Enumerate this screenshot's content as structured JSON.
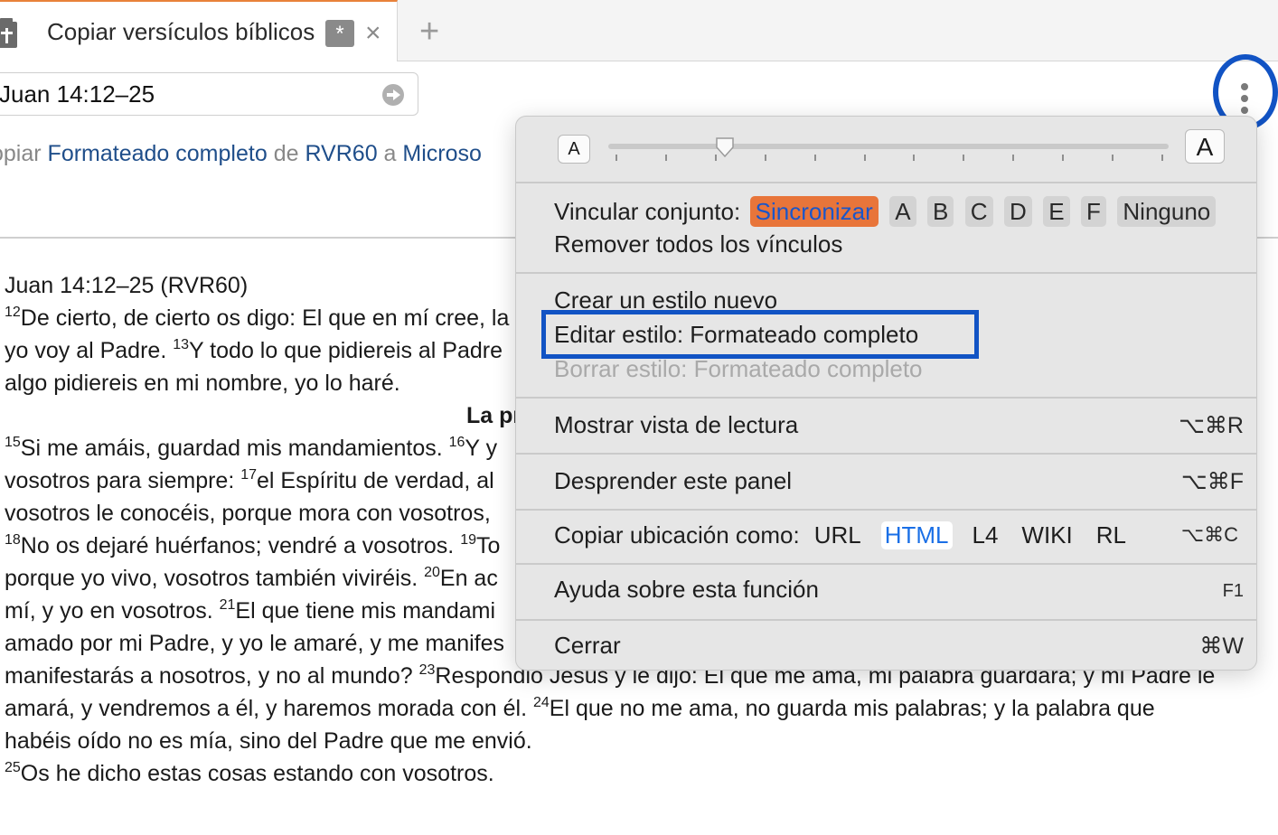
{
  "tab": {
    "title": "Copiar versículos bíblicos",
    "badge": "*",
    "close": "×",
    "add": "+"
  },
  "reference": {
    "value": "Juan 14:12–25"
  },
  "copy_line": {
    "prefix": "opiar",
    "style": "Formateado completo",
    "from_word": "de",
    "version": "RVR60",
    "to_word": "a",
    "target": "Microso"
  },
  "passage": {
    "lines": [
      {
        "segments": [
          {
            "t": "Juan 14:12–25 (RVR60)"
          }
        ]
      },
      {
        "segments": [
          {
            "sup": "12"
          },
          {
            "t": "De cierto, de cierto os digo: El que en mí cree, la"
          }
        ]
      },
      {
        "segments": [
          {
            "t": "yo voy al Padre. "
          },
          {
            "sup": "13"
          },
          {
            "t": "Y todo lo que pidiereis al Padre"
          }
        ]
      },
      {
        "segments": [
          {
            "t": "algo pidiereis en mi nombre, yo lo haré."
          }
        ]
      },
      {
        "heading": "La pr"
      },
      {
        "segments": [
          {
            "sup": "15"
          },
          {
            "t": "Si me amáis, guardad mis mandamientos. "
          },
          {
            "sup": "16"
          },
          {
            "t": "Y y"
          }
        ]
      },
      {
        "segments": [
          {
            "t": "vosotros para siempre: "
          },
          {
            "sup": "17"
          },
          {
            "t": "el Espíritu de verdad, al"
          }
        ]
      },
      {
        "segments": [
          {
            "t": "vosotros le conocéis, porque mora con vosotros,"
          }
        ]
      },
      {
        "segments": [
          {
            "sup": "18"
          },
          {
            "t": "No os dejaré huérfanos; vendré a vosotros. "
          },
          {
            "sup": "19"
          },
          {
            "t": "To"
          }
        ]
      },
      {
        "segments": [
          {
            "t": "porque yo vivo, vosotros también viviréis. "
          },
          {
            "sup": "20"
          },
          {
            "t": "En ac"
          }
        ]
      },
      {
        "segments": [
          {
            "t": "mí, y yo en vosotros. "
          },
          {
            "sup": "21"
          },
          {
            "t": "El que tiene mis mandami"
          }
        ]
      },
      {
        "segments": [
          {
            "t": "amado por mi Padre, y yo le amaré, y me manifes"
          }
        ]
      },
      {
        "segments": [
          {
            "t": "manifestarás a nosotros, y no al mundo? "
          },
          {
            "sup": "23"
          },
          {
            "t": "Respondió Jesús y le dijo: El que me ama, mi palabra guardará; y mi Padre le"
          }
        ]
      },
      {
        "segments": [
          {
            "t": "amará, y vendremos a él, y haremos morada con él. "
          },
          {
            "sup": "24"
          },
          {
            "t": "El que no me ama, no guarda mis palabras; y la palabra que"
          }
        ]
      },
      {
        "segments": [
          {
            "t": "habéis oído no es mía, sino del Padre que me envió."
          }
        ]
      },
      {
        "segments": [
          {
            "sup": "25"
          },
          {
            "t": "Os he dicho estas cosas estando con vosotros."
          }
        ]
      }
    ]
  },
  "menu": {
    "font_small": "A",
    "font_large": "A",
    "font_size_level": 0.2,
    "link_set": {
      "label": "Vincular conjunto:",
      "options": [
        "Sincronizar",
        "A",
        "B",
        "C",
        "D",
        "E",
        "F",
        "Ninguno"
      ],
      "selected": "Sincronizar"
    },
    "remove_links": "Remover todos los vínculos",
    "create_style": "Crear un estilo nuevo",
    "edit_style": "Editar estilo: Formateado completo",
    "delete_style": "Borrar estilo: Formateado completo",
    "reading_view": {
      "label": "Mostrar vista de lectura",
      "shortcut": "⌥⌘R"
    },
    "detach_panel": {
      "label": "Desprender este panel",
      "shortcut": "⌥⌘F"
    },
    "copy_location": {
      "label": "Copiar ubicación como:",
      "formats": [
        "URL",
        "HTML",
        "L4",
        "WIKI",
        "RL"
      ],
      "selected": "HTML",
      "shortcut": "⌥⌘C"
    },
    "help": {
      "label": "Ayuda sobre esta función",
      "shortcut": "F1"
    },
    "close": {
      "label": "Cerrar",
      "shortcut": "⌘W"
    }
  },
  "colors": {
    "tab_accent": "#e8823a",
    "sync_highlight": "#e8753a",
    "link_blue": "#1f4e8a",
    "annotation_blue": "#1153c4",
    "selected_format": "#1a6fe6"
  },
  "icons": {
    "tab": "document-cross-icon",
    "go": "arrow-circle-right-icon",
    "menu": "vertical-ellipsis-icon"
  }
}
